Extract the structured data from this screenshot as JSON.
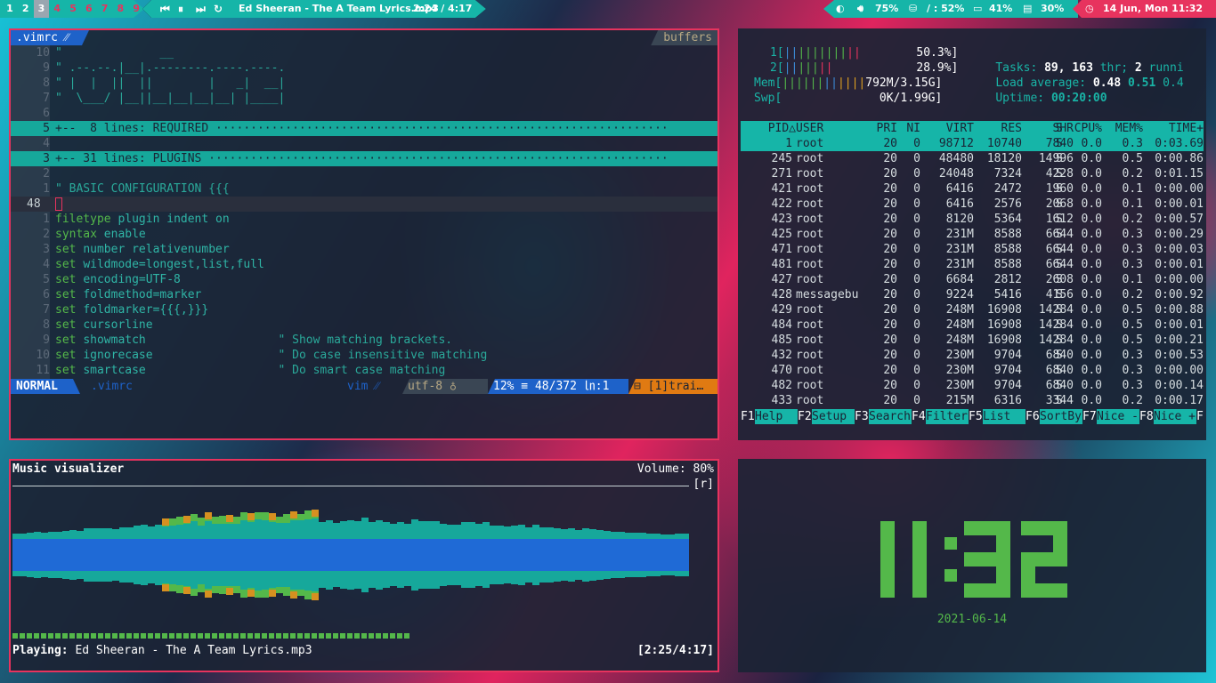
{
  "topbar": {
    "workspaces": [
      {
        "label": "1",
        "state": "occ"
      },
      {
        "label": "2",
        "state": "occ"
      },
      {
        "label": "3",
        "state": "active"
      },
      {
        "label": "4",
        "state": "empty"
      },
      {
        "label": "5",
        "state": "empty"
      },
      {
        "label": "6",
        "state": "empty"
      },
      {
        "label": "7",
        "state": "empty"
      },
      {
        "label": "8",
        "state": "empty"
      },
      {
        "label": "9",
        "state": "empty"
      }
    ],
    "media": {
      "prev_icon": "skip-previous-icon",
      "pause_icon": "pause-icon",
      "next_icon": "skip-next-icon",
      "repeat_icon": "repeat-icon",
      "title": "Ed Sheeran - The A Team Lyrics.mp3",
      "time": "2:24 / 4:17"
    },
    "status": {
      "volume": "75%",
      "disk": "/ : 52%",
      "cpu": "41%",
      "mem": "30%",
      "datetime": "14 Jun, Mon 11:32"
    },
    "colors": {
      "accent": "#16b5a8",
      "alert": "#e7335e"
    }
  },
  "vim": {
    "tab": ".vimrc ⁄⁄",
    "buffers_label": "buffers",
    "lines": [
      {
        "num": "10",
        "text": "\"              __",
        "kind": "comment"
      },
      {
        "num": "9",
        "text": "\" .--.--.|__|.--------.----.----.",
        "kind": "comment"
      },
      {
        "num": "8",
        "text": "\" |  |  ||  ||        |   _|  __|",
        "kind": "comment"
      },
      {
        "num": "7",
        "text": "\"  \\___/ |__||__|__|__|__| |____|",
        "kind": "comment"
      },
      {
        "num": "6",
        "text": "",
        "kind": "plain"
      },
      {
        "num": "5",
        "text": "+--  8 lines: REQUIRED ·································································",
        "kind": "fold"
      },
      {
        "num": "4",
        "text": "",
        "kind": "plain"
      },
      {
        "num": "3",
        "text": "+-- 31 lines: PLUGINS ··································································",
        "kind": "fold"
      },
      {
        "num": "2",
        "text": "",
        "kind": "plain"
      },
      {
        "num": "1",
        "text": "\" BASIC CONFIGURATION {{{",
        "kind": "comment"
      },
      {
        "num": "48",
        "text": "",
        "kind": "cursor"
      },
      {
        "num": "1",
        "text": "filetype plugin indent on",
        "kind": "code"
      },
      {
        "num": "2",
        "text": "syntax enable",
        "kind": "code"
      },
      {
        "num": "3",
        "text": "set number relativenumber",
        "kind": "code"
      },
      {
        "num": "4",
        "text": "set wildmode=longest,list,full",
        "kind": "code"
      },
      {
        "num": "5",
        "text": "set encoding=UTF-8",
        "kind": "code"
      },
      {
        "num": "6",
        "text": "set foldmethod=marker",
        "kind": "code"
      },
      {
        "num": "7",
        "text": "set foldmarker={{{,}}}",
        "kind": "code"
      },
      {
        "num": "8",
        "text": "set cursorline",
        "kind": "code"
      },
      {
        "num": "9",
        "text": "set showmatch                   \" Show matching brackets.",
        "kind": "code"
      },
      {
        "num": "10",
        "text": "set ignorecase                  \" Do case insensitive matching",
        "kind": "code"
      },
      {
        "num": "11",
        "text": "set smartcase                   \" Do smart case matching",
        "kind": "code"
      }
    ],
    "status": {
      "mode": "NORMAL",
      "file": ".vimrc",
      "filetype": "vim ⁄⁄",
      "encoding": "utf-8 ♁",
      "percent": "12% ≡ 48/372 ㏑:1",
      "warning": "⊟ [1]trai…"
    }
  },
  "htop": {
    "meters": [
      {
        "label": "1[",
        "bar": "|||||||||||",
        "value": "50.3%]"
      },
      {
        "label": "2[",
        "bar": "|||||||",
        "value": "28.9%]"
      },
      {
        "label": "Mem[",
        "bar": "||||||||||||",
        "value": "792M/3.15G]"
      },
      {
        "label": "Swp[",
        "bar": "",
        "value": "0K/1.99G]"
      }
    ],
    "summary": {
      "tasks_label": "Tasks:",
      "tasks": "89,",
      "thr": "163",
      "thr_label": "thr;",
      "run": "2",
      "run_label": "runni",
      "load_label": "Load average:",
      "load1": "0.48",
      "load5": "0.51",
      "load15": "0.4",
      "uptime_label": "Uptime:",
      "uptime": "00:20:00"
    },
    "columns": [
      "PID△",
      "USER",
      "PRI",
      "NI",
      "VIRT",
      "RES",
      "SHR",
      "S",
      "CPU%",
      "MEM%",
      "TIME+"
    ],
    "processes": [
      [
        "1",
        "root",
        "20",
        "0",
        "98712",
        "10740",
        "7840",
        "S",
        "0.0",
        "0.3",
        "0:03.69"
      ],
      [
        "245",
        "root",
        "20",
        "0",
        "48480",
        "18120",
        "14996",
        "S",
        "0.0",
        "0.5",
        "0:00.86"
      ],
      [
        "271",
        "root",
        "20",
        "0",
        "24048",
        "7324",
        "4228",
        "S",
        "0.0",
        "0.2",
        "0:01.15"
      ],
      [
        "421",
        "root",
        "20",
        "0",
        "6416",
        "2472",
        "1960",
        "S",
        "0.0",
        "0.1",
        "0:00.00"
      ],
      [
        "422",
        "root",
        "20",
        "0",
        "6416",
        "2576",
        "2068",
        "S",
        "0.0",
        "0.1",
        "0:00.01"
      ],
      [
        "423",
        "root",
        "20",
        "0",
        "8120",
        "5364",
        "1612",
        "S",
        "0.0",
        "0.2",
        "0:00.57"
      ],
      [
        "425",
        "root",
        "20",
        "0",
        "231M",
        "8588",
        "6644",
        "S",
        "0.0",
        "0.3",
        "0:00.29"
      ],
      [
        "471",
        "root",
        "20",
        "0",
        "231M",
        "8588",
        "6644",
        "S",
        "0.0",
        "0.3",
        "0:00.03"
      ],
      [
        "481",
        "root",
        "20",
        "0",
        "231M",
        "8588",
        "6644",
        "S",
        "0.0",
        "0.3",
        "0:00.01"
      ],
      [
        "427",
        "root",
        "20",
        "0",
        "6684",
        "2812",
        "2608",
        "S",
        "0.0",
        "0.1",
        "0:00.00"
      ],
      [
        "428",
        "messagebu",
        "20",
        "0",
        "9224",
        "5416",
        "4156",
        "S",
        "0.0",
        "0.2",
        "0:00.92"
      ],
      [
        "429",
        "root",
        "20",
        "0",
        "248M",
        "16908",
        "14284",
        "S",
        "0.0",
        "0.5",
        "0:00.88"
      ],
      [
        "484",
        "root",
        "20",
        "0",
        "248M",
        "16908",
        "14284",
        "S",
        "0.0",
        "0.5",
        "0:00.01"
      ],
      [
        "485",
        "root",
        "20",
        "0",
        "248M",
        "16908",
        "14284",
        "S",
        "0.0",
        "0.5",
        "0:00.21"
      ],
      [
        "432",
        "root",
        "20",
        "0",
        "230M",
        "9704",
        "6840",
        "S",
        "0.0",
        "0.3",
        "0:00.53"
      ],
      [
        "470",
        "root",
        "20",
        "0",
        "230M",
        "9704",
        "6840",
        "S",
        "0.0",
        "0.3",
        "0:00.00"
      ],
      [
        "482",
        "root",
        "20",
        "0",
        "230M",
        "9704",
        "6840",
        "S",
        "0.0",
        "0.3",
        "0:00.14"
      ],
      [
        "433",
        "root",
        "20",
        "0",
        "215M",
        "6316",
        "3344",
        "S",
        "0.0",
        "0.2",
        "0:00.17"
      ]
    ],
    "fkeys": [
      {
        "key": "F1",
        "label": "Help  "
      },
      {
        "key": "F2",
        "label": "Setup "
      },
      {
        "key": "F3",
        "label": "Search"
      },
      {
        "key": "F4",
        "label": "Filter"
      },
      {
        "key": "F5",
        "label": "List  "
      },
      {
        "key": "F6",
        "label": "SortBy"
      },
      {
        "key": "F7",
        "label": "Nice -"
      },
      {
        "key": "F8",
        "label": "Nice +"
      },
      {
        "key": "F",
        "label": ""
      }
    ]
  },
  "visualizer": {
    "title": "Music visualizer",
    "volume": "Volume: 80%",
    "repeat_flag": "[r]",
    "playing_label": "Playing:",
    "playing": "Ed Sheeran - The A Team Lyrics.mp3",
    "position": "[2:25/4:17]",
    "progress": 0.58
  },
  "clock": {
    "time": "11:32",
    "date": "2021-06-14"
  }
}
